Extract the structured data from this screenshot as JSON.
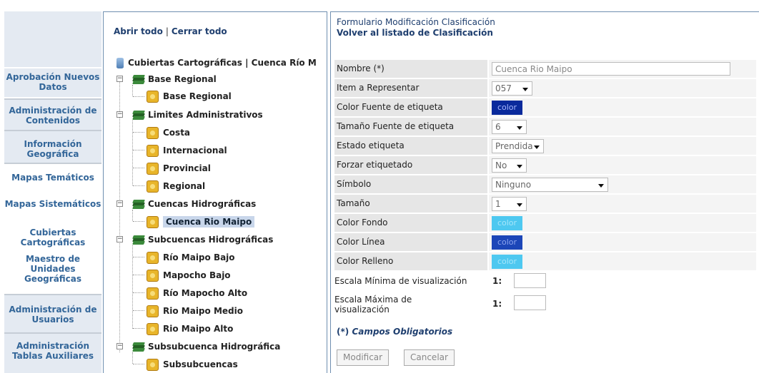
{
  "nav": {
    "items": [
      {
        "label": "Aprobación Nuevos Datos"
      },
      {
        "label": "Administración de Contenidos"
      },
      {
        "label": "Información Geográfica"
      },
      {
        "label": "Mapas Temáticos"
      },
      {
        "label": "Mapas Sistemáticos"
      },
      {
        "label": "Cubiertas Cartográficas"
      },
      {
        "label": "Maestro de Unidades Geográficas"
      },
      {
        "label": "Administración de Usuarios"
      },
      {
        "label": "Administración Tablas Auxiliares"
      }
    ]
  },
  "tree": {
    "open_all": "Abrir todo",
    "separator": "|",
    "close_all": "Cerrar todo",
    "root": "Cubiertas Cartográficas | Cuenca Río M",
    "groups": [
      {
        "label": "Base Regional",
        "expander": "−",
        "children": [
          "Base Regional"
        ]
      },
      {
        "label": "Limites Administrativos",
        "expander": "−",
        "children": [
          "Costa",
          "Internacional",
          "Provincial",
          "Regional"
        ]
      },
      {
        "label": "Cuencas Hidrográficas",
        "expander": "−",
        "children": [
          "Cuenca Rio Maipo"
        ]
      },
      {
        "label": "Subcuencas Hidrográficas",
        "expander": "−",
        "children": [
          "Río Maipo Bajo",
          "Mapocho Bajo",
          "Río Mapocho Alto",
          "Rio Maipo Medio",
          "Rio Maipo Alto"
        ]
      },
      {
        "label": "Subsubcuenca Hidrográfica",
        "expander": "−",
        "children": [
          "Subsubcuencas"
        ]
      }
    ]
  },
  "form": {
    "title": "Formulario Modificación Clasificación",
    "back_link": "Volver al listado de Clasificación",
    "fields": {
      "nombre": {
        "label": "Nombre (*)",
        "value": "Cuenca Rio Maipo"
      },
      "item": {
        "label": "Item a Representar",
        "value": "057"
      },
      "color_fuente": {
        "label": "Color Fuente de etiqueta",
        "value": "color",
        "color": "#0a2a9c"
      },
      "tamano_fuente": {
        "label": "Tamaño Fuente de etiqueta",
        "value": "6"
      },
      "estado": {
        "label": "Estado etiqueta",
        "value": "Prendida"
      },
      "forzar": {
        "label": "Forzar etiquetado",
        "value": "No"
      },
      "simbolo": {
        "label": "Símbolo",
        "value": "Ninguno"
      },
      "tamano": {
        "label": "Tamaño",
        "value": "1"
      },
      "color_fondo": {
        "label": "Color Fondo",
        "value": "color",
        "color": "#4ec8f0"
      },
      "color_linea": {
        "label": "Color Línea",
        "value": "color",
        "color": "#1c46b8"
      },
      "color_relleno": {
        "label": "Color Relleno",
        "value": "color",
        "color": "#4ec8f0"
      }
    },
    "escala_min": {
      "label": "Escala Mínima de visualización",
      "prefix": "1:",
      "value": ""
    },
    "escala_max": {
      "label": "Escala Máxima de visualización",
      "prefix": "1:",
      "value": ""
    },
    "required_note": {
      "mark": "(*)",
      "text": "Campos Obligatorios"
    },
    "buttons": {
      "modify": "Modificar",
      "cancel": "Cancelar"
    }
  }
}
